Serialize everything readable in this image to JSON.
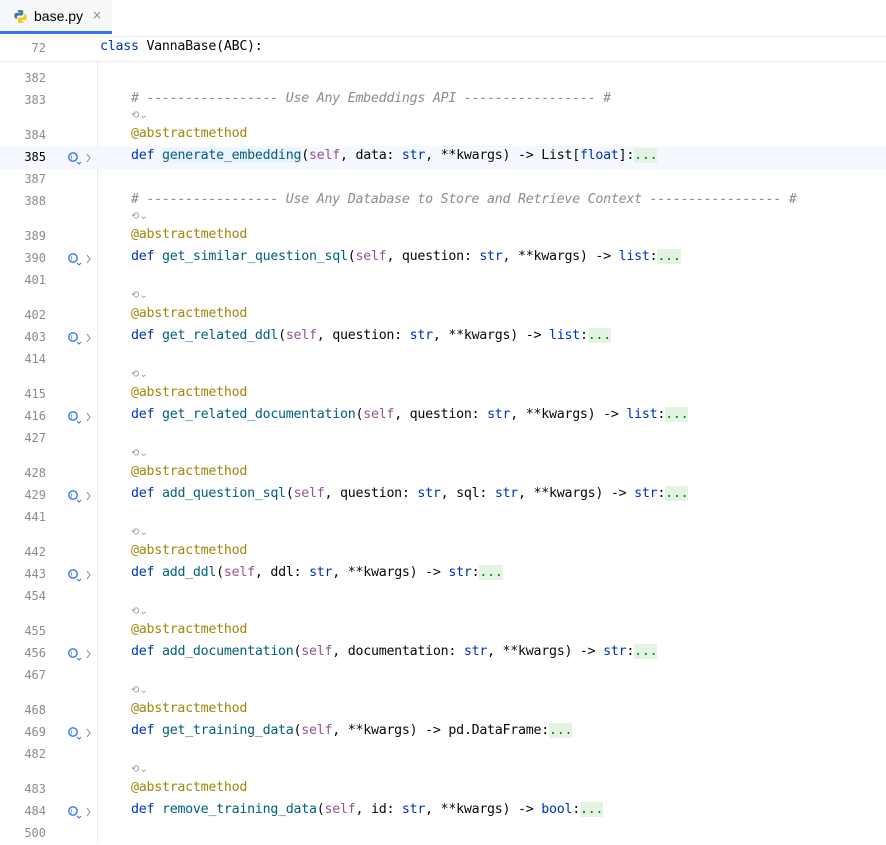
{
  "tab": {
    "filename": "base.py",
    "close_glyph": "×"
  },
  "sticky": {
    "line_number": "72",
    "code": "class VannaBase(ABC):"
  },
  "lines": {
    "l382": {
      "num": "382"
    },
    "l383": {
      "num": "383",
      "comment": "# ----------------- Use Any Embeddings API ----------------- #"
    },
    "l384": {
      "num": "384",
      "decorator": "@abstractmethod"
    },
    "l385": {
      "num": "385",
      "kw": "def",
      "fn": "generate_embedding",
      "pre": "(",
      "self": "self",
      "rest": ", data: ",
      "t1": "str",
      "rest2": ", **kwargs) -> List[",
      "t2": "float",
      "rest3": "]:",
      "fold": "..."
    },
    "l387": {
      "num": "387"
    },
    "l388": {
      "num": "388",
      "comment": "# ----------------- Use Any Database to Store and Retrieve Context ----------------- #"
    },
    "l389": {
      "num": "389",
      "decorator": "@abstractmethod"
    },
    "l390": {
      "num": "390",
      "kw": "def",
      "fn": "get_similar_question_sql",
      "pre": "(",
      "self": "self",
      "rest": ", question: ",
      "t1": "str",
      "rest2": ", **kwargs) -> ",
      "t2": "list",
      "rest3": ":",
      "fold": "..."
    },
    "l401": {
      "num": "401"
    },
    "l402": {
      "num": "402",
      "decorator": "@abstractmethod"
    },
    "l403": {
      "num": "403",
      "kw": "def",
      "fn": "get_related_ddl",
      "pre": "(",
      "self": "self",
      "rest": ", question: ",
      "t1": "str",
      "rest2": ", **kwargs) -> ",
      "t2": "list",
      "rest3": ":",
      "fold": "..."
    },
    "l414": {
      "num": "414"
    },
    "l415": {
      "num": "415",
      "decorator": "@abstractmethod"
    },
    "l416": {
      "num": "416",
      "kw": "def",
      "fn": "get_related_documentation",
      "pre": "(",
      "self": "self",
      "rest": ", question: ",
      "t1": "str",
      "rest2": ", **kwargs) -> ",
      "t2": "list",
      "rest3": ":",
      "fold": "..."
    },
    "l427": {
      "num": "427"
    },
    "l428": {
      "num": "428",
      "decorator": "@abstractmethod"
    },
    "l429": {
      "num": "429",
      "kw": "def",
      "fn": "add_question_sql",
      "pre": "(",
      "self": "self",
      "rest": ", question: ",
      "t1": "str",
      "rest2": ", sql: ",
      "t2": "str",
      "rest3": ", **kwargs) -> ",
      "t3": "str",
      "rest4": ":",
      "fold": "..."
    },
    "l441": {
      "num": "441"
    },
    "l442": {
      "num": "442",
      "decorator": "@abstractmethod"
    },
    "l443": {
      "num": "443",
      "kw": "def",
      "fn": "add_ddl",
      "pre": "(",
      "self": "self",
      "rest": ", ddl: ",
      "t1": "str",
      "rest2": ", **kwargs) -> ",
      "t2": "str",
      "rest3": ":",
      "fold": "..."
    },
    "l454": {
      "num": "454"
    },
    "l455": {
      "num": "455",
      "decorator": "@abstractmethod"
    },
    "l456": {
      "num": "456",
      "kw": "def",
      "fn": "add_documentation",
      "pre": "(",
      "self": "self",
      "rest": ", documentation: ",
      "t1": "str",
      "rest2": ", **kwargs) -> ",
      "t2": "str",
      "rest3": ":",
      "fold": "..."
    },
    "l467": {
      "num": "467"
    },
    "l468": {
      "num": "468",
      "decorator": "@abstractmethod"
    },
    "l469": {
      "num": "469",
      "kw": "def",
      "fn": "get_training_data",
      "pre": "(",
      "self": "self",
      "rest": ", **kwargs) -> pd.DataFrame:",
      "fold": "..."
    },
    "l482": {
      "num": "482"
    },
    "l483": {
      "num": "483",
      "decorator": "@abstractmethod"
    },
    "l484": {
      "num": "484",
      "kw": "def",
      "fn": "remove_training_data",
      "pre": "(",
      "self": "self",
      "rest": ", id: ",
      "t1": "str",
      "rest2": ", **kwargs) -> ",
      "t2": "bool",
      "rest3": ":",
      "fold": "..."
    },
    "l500": {
      "num": "500"
    }
  },
  "colors": {
    "keyword": "#0033b3",
    "self": "#94558d",
    "function": "#00627a",
    "decorator": "#9e880d",
    "comment": "#8c8c8c",
    "fold_bg": "#e3f4e3",
    "caret_row": "#f5f8fe"
  },
  "icons": {
    "file": "python-file-icon",
    "gutter": "implementing-method-icon",
    "hint": "inlay-hint-icon"
  }
}
